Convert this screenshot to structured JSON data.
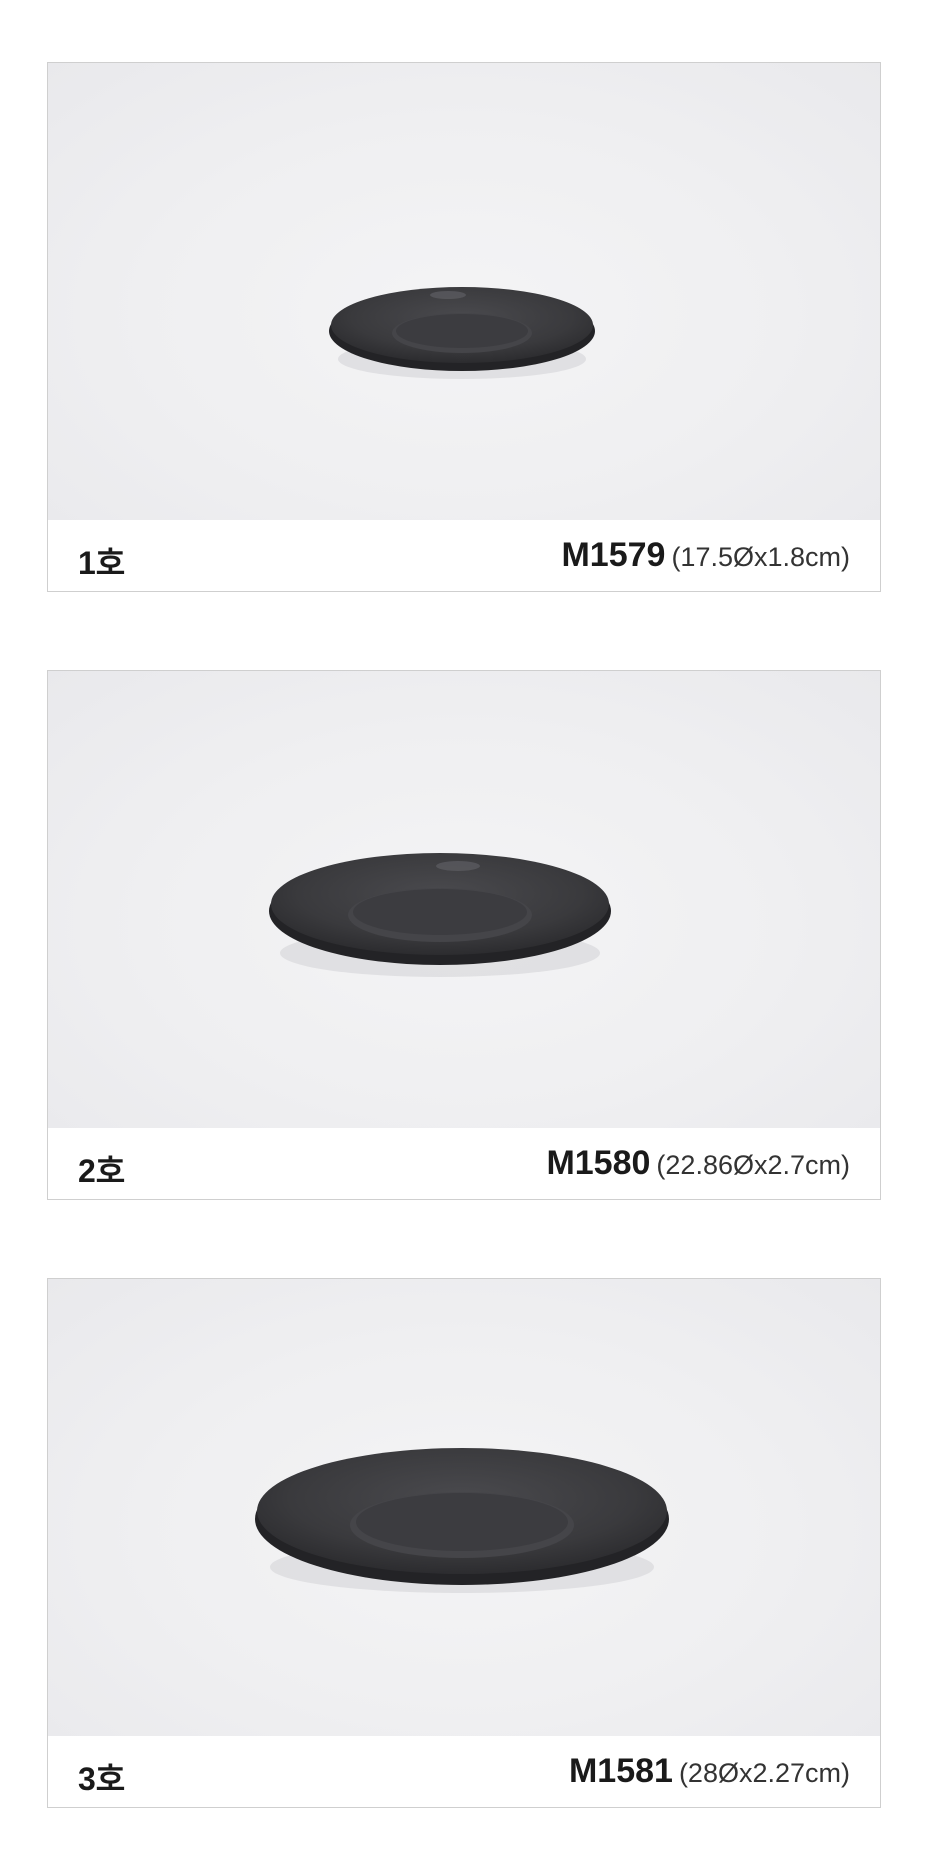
{
  "products": [
    {
      "size": "1호",
      "code": "M1579",
      "dimensions": "(17.5Øx1.8cm)",
      "image": "black-plate-photo"
    },
    {
      "size": "2호",
      "code": "M1580",
      "dimensions": "(22.86Øx2.7cm)",
      "image": "black-plate-photo"
    },
    {
      "size": "3호",
      "code": "M1581",
      "dimensions": "(28Øx2.27cm)",
      "image": "black-plate-photo"
    }
  ],
  "colors": {
    "plate": "#3a3a3d",
    "background": "#efeff1",
    "border": "#cfcfcf"
  }
}
